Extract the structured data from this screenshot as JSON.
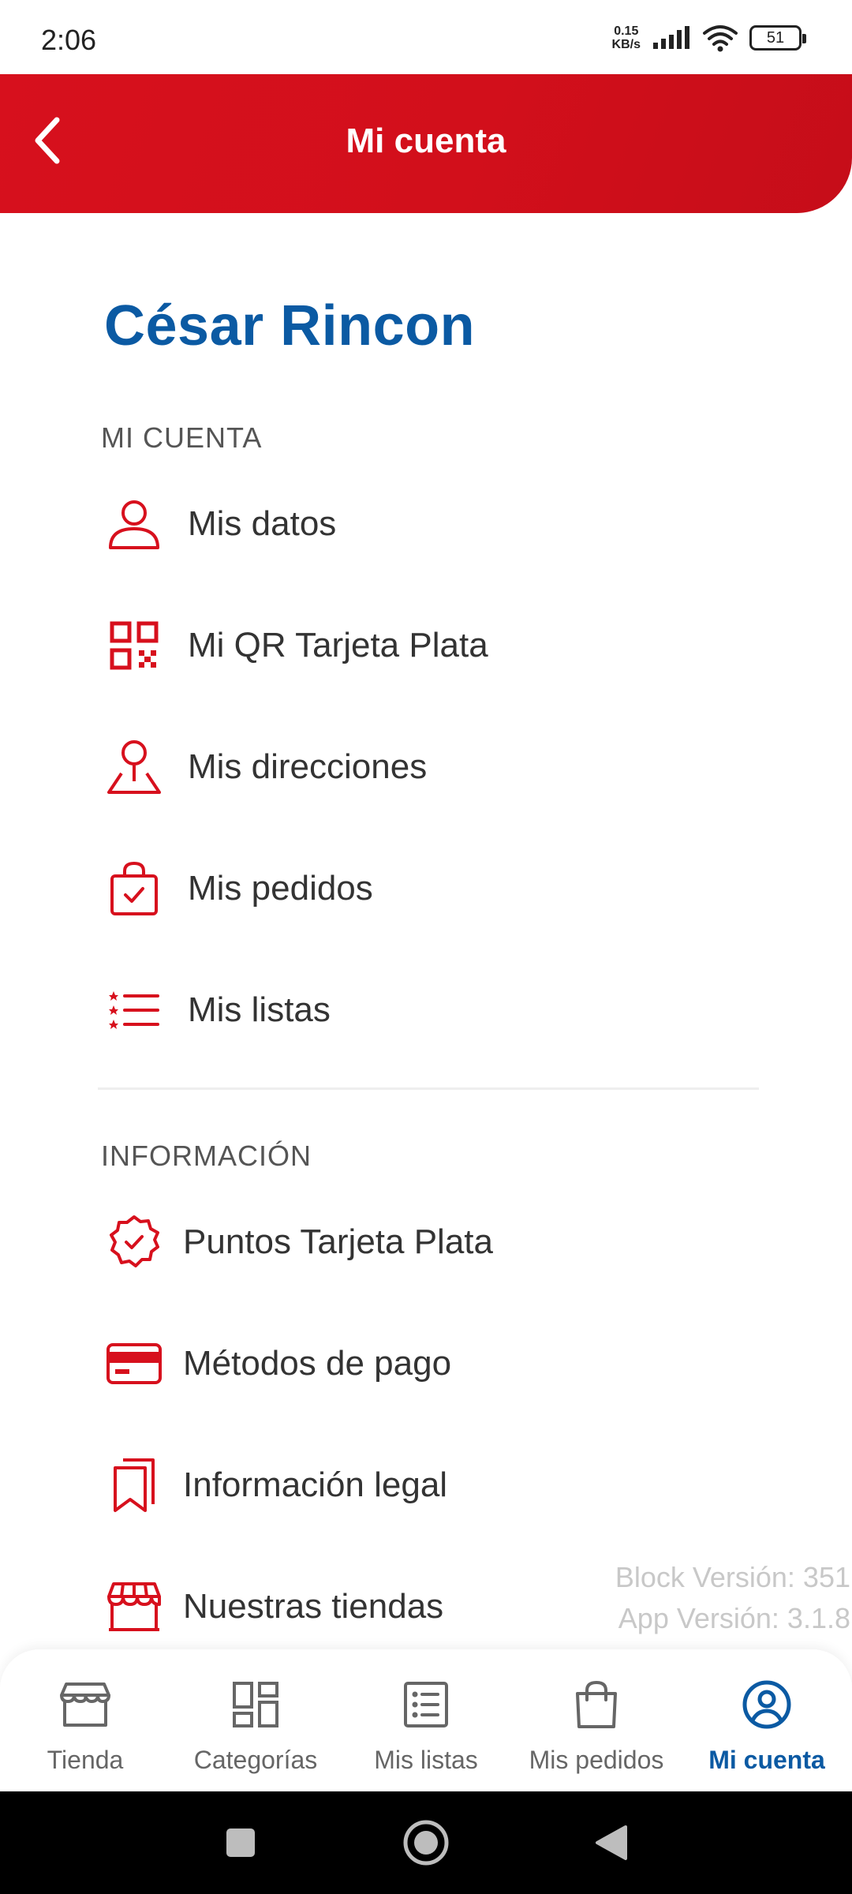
{
  "status_bar": {
    "time": "2:06",
    "net_speed_value": "0.15",
    "net_speed_unit": "KB/s",
    "battery": "51"
  },
  "header": {
    "title": "Mi cuenta"
  },
  "user": {
    "name": "César Rincon"
  },
  "account_section": {
    "title": "MI CUENTA",
    "items": [
      {
        "label": "Mis datos",
        "icon": "user-icon"
      },
      {
        "label": "Mi QR Tarjeta Plata",
        "icon": "qr-code-icon"
      },
      {
        "label": "Mis direcciones",
        "icon": "location-pin-icon"
      },
      {
        "label": "Mis pedidos",
        "icon": "shopping-bag-check-icon"
      },
      {
        "label": "Mis listas",
        "icon": "list-stars-icon"
      }
    ]
  },
  "info_section": {
    "title": "INFORMACIÓN",
    "items": [
      {
        "label": "Puntos Tarjeta Plata",
        "icon": "badge-check-icon"
      },
      {
        "label": "Métodos de pago",
        "icon": "credit-card-icon"
      },
      {
        "label": "Información legal",
        "icon": "bookmarks-icon"
      },
      {
        "label": "Nuestras tiendas",
        "icon": "store-icon"
      }
    ]
  },
  "version": {
    "block": "Block Versión: 351",
    "app": "App Versión: 3.1.8"
  },
  "bottom_nav": {
    "items": [
      {
        "label": "Tienda",
        "icon": "store-icon"
      },
      {
        "label": "Categorías",
        "icon": "grid-icon"
      },
      {
        "label": "Mis listas",
        "icon": "list-icon"
      },
      {
        "label": "Mis pedidos",
        "icon": "shopping-bag-icon"
      },
      {
        "label": "Mi cuenta",
        "icon": "user-circle-icon"
      }
    ],
    "active_index": 4
  },
  "colors": {
    "brand_red": "#d7101d",
    "brand_blue": "#0b5aa3",
    "icon_gray": "#666666"
  }
}
